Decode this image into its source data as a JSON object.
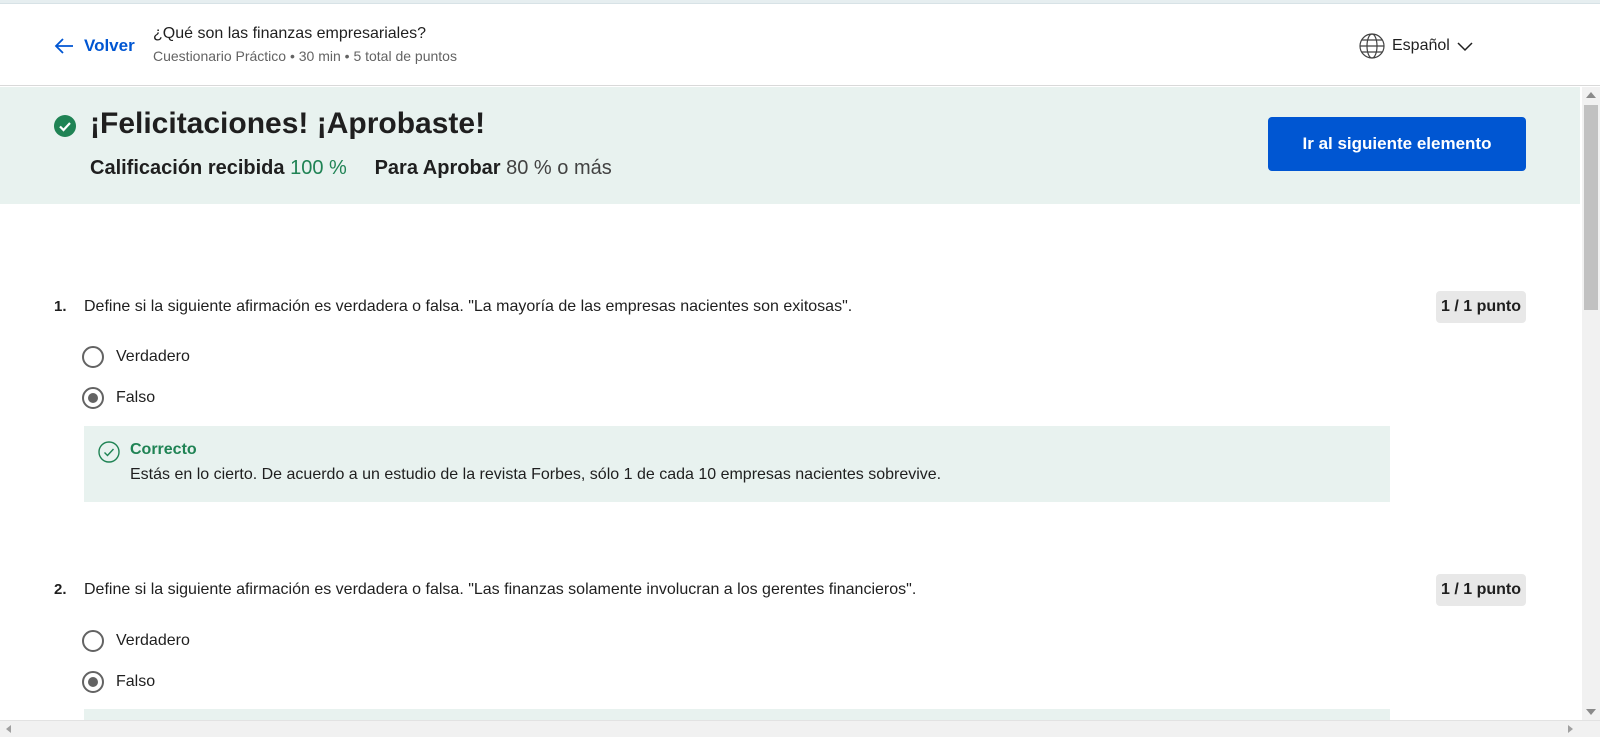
{
  "header": {
    "back_label": "Volver",
    "title": "¿Qué son las finanzas empresariales?",
    "subtitle": "Cuestionario Práctico • 30 min • 5 total de puntos",
    "language": "Español"
  },
  "banner": {
    "heading": "¡Felicitaciones! ¡Aprobaste!",
    "grade_label": "Calificación recibida",
    "grade_value": "100 %",
    "pass_label": "Para Aprobar",
    "pass_value": "80 %",
    "pass_suffix": "o más",
    "next_button": "Ir al siguiente elemento"
  },
  "questions": [
    {
      "number": "1.",
      "text": "Define si la siguiente afirmación es verdadera o falsa. \"La mayoría de las empresas nacientes son exitosas\".",
      "points": "1 / 1 punto",
      "options": [
        {
          "label": "Verdadero",
          "selected": false
        },
        {
          "label": "Falso",
          "selected": true
        }
      ],
      "feedback_title": "Correcto",
      "feedback_text": "Estás en lo cierto. De acuerdo a un estudio de la revista Forbes, sólo 1 de cada 10 empresas nacientes sobrevive."
    },
    {
      "number": "2.",
      "text": "Define si la siguiente afirmación es verdadera o falsa. \"Las finanzas solamente involucran a los gerentes financieros\".",
      "points": "1 / 1 punto",
      "options": [
        {
          "label": "Verdadero",
          "selected": false
        },
        {
          "label": "Falso",
          "selected": true
        }
      ]
    }
  ],
  "colors": {
    "accent": "#0056d2",
    "success": "#1f8354",
    "banner_bg": "#e8f2ef"
  }
}
